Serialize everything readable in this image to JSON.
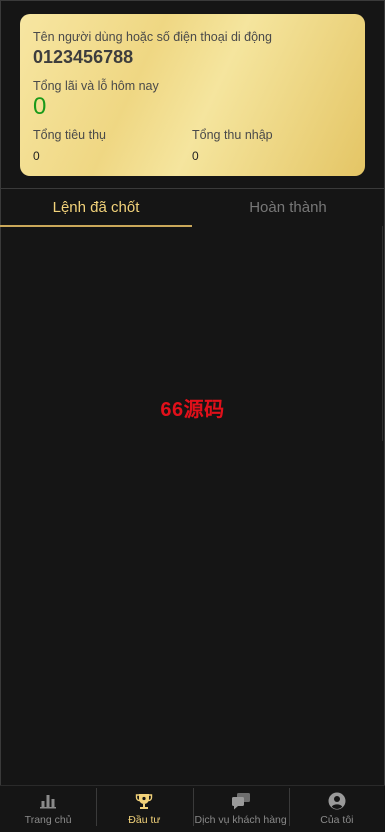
{
  "account": {
    "name_label": "Tên người dùng hoặc số điện thoại di động",
    "phone": "0123456788",
    "pnl_label": "Tổng lãi và lỗ hôm nay",
    "pnl_value": "0",
    "spend_label": "Tổng tiêu thụ",
    "spend_value": "0",
    "income_label": "Tổng thu nhập",
    "income_value": "0"
  },
  "tabs": [
    {
      "label": "Lệnh đã chốt",
      "active": true
    },
    {
      "label": "Hoàn thành",
      "active": false
    }
  ],
  "watermark": "66源码",
  "tabbar": [
    {
      "label": "Trang chủ",
      "icon": "bar-chart-icon",
      "active": false
    },
    {
      "label": "Đầu tư",
      "icon": "trophy-icon",
      "active": true
    },
    {
      "label": "Dịch vụ khách hàng",
      "icon": "chat-bubbles-icon",
      "active": false
    },
    {
      "label": "Của tôi",
      "icon": "user-avatar-icon",
      "active": false
    }
  ],
  "colors": {
    "background": "#151515",
    "accent_gold": "#f2d27a",
    "profit_green": "#1a9a1a",
    "watermark_red": "#e0101a"
  }
}
